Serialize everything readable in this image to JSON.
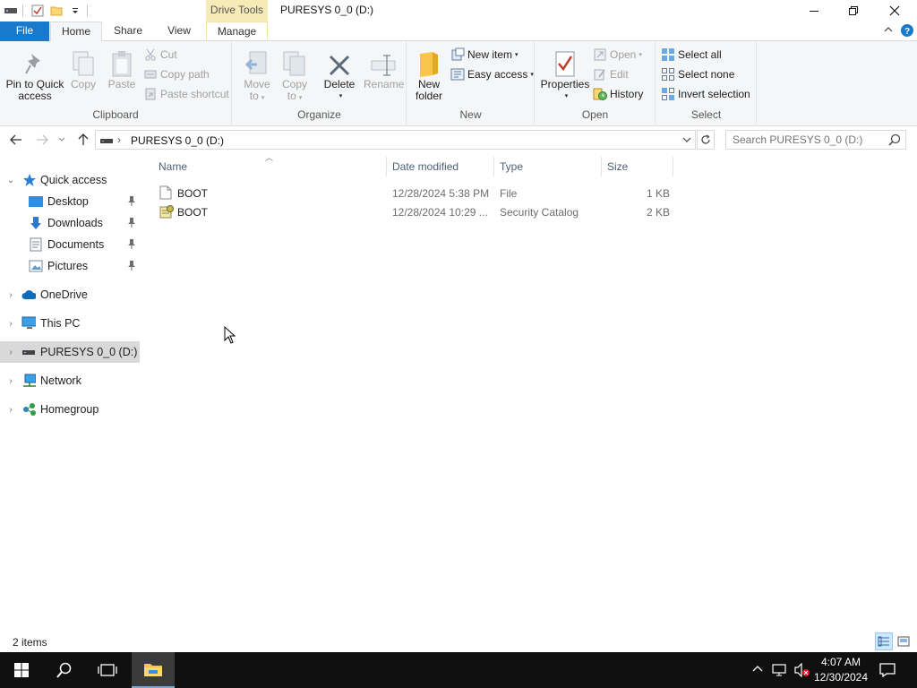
{
  "window": {
    "title": "PURESYS 0_0 (D:)",
    "context_tab": "Drive Tools"
  },
  "tabs": {
    "file": "File",
    "home": "Home",
    "share": "Share",
    "view": "View",
    "manage": "Manage"
  },
  "ribbon": {
    "clipboard": {
      "label": "Clipboard",
      "pin_line1": "Pin to Quick",
      "pin_line2": "access",
      "copy": "Copy",
      "paste": "Paste",
      "cut": "Cut",
      "copy_path": "Copy path",
      "paste_shortcut": "Paste shortcut"
    },
    "organize": {
      "label": "Organize",
      "move_line1": "Move",
      "move_line2": "to",
      "copy_line1": "Copy",
      "copy_line2": "to",
      "delete": "Delete",
      "rename": "Rename"
    },
    "new": {
      "label": "New",
      "folder_line1": "New",
      "folder_line2": "folder",
      "new_item": "New item",
      "easy_access": "Easy access"
    },
    "open": {
      "label": "Open",
      "properties": "Properties",
      "open": "Open",
      "edit": "Edit",
      "history": "History"
    },
    "select": {
      "label": "Select",
      "select_all": "Select all",
      "select_none": "Select none",
      "invert": "Invert selection"
    }
  },
  "address": {
    "path": "PURESYS 0_0 (D:)",
    "search_placeholder": "Search PURESYS 0_0 (D:)"
  },
  "nav": {
    "quick_access": "Quick access",
    "desktop": "Desktop",
    "downloads": "Downloads",
    "documents": "Documents",
    "pictures": "Pictures",
    "onedrive": "OneDrive",
    "this_pc": "This PC",
    "drive": "PURESYS 0_0 (D:)",
    "network": "Network",
    "homegroup": "Homegroup"
  },
  "columns": {
    "name": "Name",
    "date": "Date modified",
    "type": "Type",
    "size": "Size"
  },
  "files": [
    {
      "name": "BOOT",
      "date": "12/28/2024 5:38 PM",
      "type": "File",
      "size": "1 KB",
      "icon": "file-icon"
    },
    {
      "name": "BOOT",
      "date": "12/28/2024 10:29 ...",
      "type": "Security Catalog",
      "size": "2 KB",
      "icon": "security-catalog-icon"
    }
  ],
  "status": {
    "items": "2 items"
  },
  "taskbar": {
    "time": "4:07 AM",
    "date": "12/30/2024"
  },
  "colors": {
    "accent": "#1979ca",
    "context_tab": "#f6ebb6",
    "selection": "#d9d9d9",
    "taskbar": "#101010"
  }
}
